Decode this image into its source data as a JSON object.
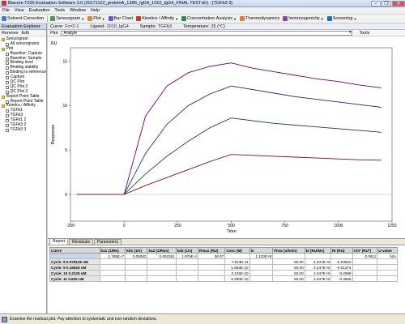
{
  "window": {
    "title": "Biacore T200 Evaluation Software 3.0 (20171122_proteinA_13A5_IgG4_1010_IgG4_FINAL TEST.blr) - [TGFb3 3]",
    "minimize": "–",
    "restore": "❐",
    "close": "✕"
  },
  "menu": [
    "File",
    "View",
    "Evaluation",
    "Tools",
    "Window",
    "Help"
  ],
  "toolbar": {
    "solvent": "Solvent Correction",
    "sensorgram": "Sensorgram",
    "plot": "Plot",
    "bar_chart": "Bar Chart",
    "kinetics": "Kinetics / Affinity",
    "concentration": "Concentration Analysis",
    "thermodynamics": "Thermodynamics",
    "immunogenicity": "Immunogenicity",
    "screening": "Screening"
  },
  "explorer": {
    "title": "Evaluation Explorer",
    "remove": "Remove",
    "edit": "Edit",
    "tree": [
      {
        "label": "Sensorgram",
        "level": 1,
        "folder": true
      },
      {
        "label": "All sensorgrams",
        "level": 2,
        "folder": false
      },
      {
        "label": "Plot",
        "level": 1,
        "folder": true
      },
      {
        "label": "Baseline: Capture",
        "level": 2,
        "folder": false
      },
      {
        "label": "Baseline: Sample",
        "level": 2,
        "folder": false
      },
      {
        "label": "Binding level",
        "level": 2,
        "folder": false
      },
      {
        "label": "Binding stability",
        "level": 2,
        "folder": false
      },
      {
        "label": "Binding to reference",
        "level": 2,
        "folder": false
      },
      {
        "label": "Capture",
        "level": 2,
        "folder": false
      },
      {
        "label": "QC Plot",
        "level": 2,
        "folder": false
      },
      {
        "label": "QC Plot 2",
        "level": 2,
        "folder": false
      },
      {
        "label": "QC Plot 3",
        "level": 2,
        "folder": false
      },
      {
        "label": "Report Point Table",
        "level": 1,
        "folder": true
      },
      {
        "label": "Report Point Table",
        "level": 2,
        "folder": false
      },
      {
        "label": "Kinetics / Affinity",
        "level": 1,
        "folder": true
      },
      {
        "label": "TGFb1",
        "level": 2,
        "folder": false
      },
      {
        "label": "TGFb3",
        "level": 2,
        "folder": false
      },
      {
        "label": "TGFb1 2",
        "level": 2,
        "folder": false
      },
      {
        "label": "TGFb3 2",
        "level": 2,
        "folder": false
      },
      {
        "label": "TGFb3 3",
        "level": 2,
        "folder": false
      }
    ]
  },
  "info": {
    "curve_label": "Curve:",
    "curve": "Fc=2-1",
    "ligand_label": "Ligand:",
    "ligand": "1010_IgG4",
    "sample_label": "Sample:",
    "sample": "TGFb3",
    "temp_label": "Temperature:",
    "temp": "25 (°C)"
  },
  "plotbar": {
    "label": "Plot",
    "combo": "Analyte",
    "tools": "Tools"
  },
  "chart_data": {
    "type": "line",
    "xlabel": "Time",
    "ylabel": "Response",
    "unit_label": "RU",
    "xlim": [
      -250,
      1250
    ],
    "ylim": [
      -3,
      16.5
    ],
    "xticks": [
      -250,
      0,
      250,
      500,
      750,
      1000,
      1250
    ],
    "yticks": [
      0,
      5,
      10,
      15
    ],
    "grid": false,
    "series": [
      {
        "color": "#b000b0",
        "fit_color": "#1a1a1a",
        "x": [
          0,
          100,
          200,
          300,
          400,
          500,
          600,
          700,
          800,
          900,
          1000,
          1100,
          1200
        ],
        "values": [
          0,
          8.8,
          12.2,
          13.7,
          14.4,
          14.8,
          14.2,
          13.8,
          13.4,
          13.0,
          12.7,
          12.3,
          12.0
        ]
      },
      {
        "color": "#2a3fd1",
        "fit_color": "#1a1a1a",
        "x": [
          0,
          100,
          200,
          300,
          400,
          500,
          600,
          700,
          800,
          900,
          1000,
          1100,
          1200
        ],
        "values": [
          0,
          4.6,
          7.9,
          10.0,
          11.3,
          12.2,
          11.8,
          11.4,
          11.0,
          10.7,
          10.4,
          10.1,
          9.8
        ]
      },
      {
        "color": "#1f7a1f",
        "fit_color": "#1a1a1a",
        "x": [
          0,
          100,
          200,
          300,
          400,
          500,
          600,
          700,
          800,
          900,
          1000,
          1100,
          1200
        ],
        "values": [
          0,
          2.3,
          4.3,
          6.0,
          7.5,
          8.6,
          8.3,
          8.0,
          7.8,
          7.6,
          7.4,
          7.2,
          7.0
        ]
      },
      {
        "color": "#c01818",
        "fit_color": "#1a1a1a",
        "x": [
          0,
          100,
          200,
          300,
          400,
          500,
          600,
          700,
          800,
          900,
          1000,
          1100,
          1200
        ],
        "values": [
          0,
          1.0,
          1.9,
          2.8,
          3.7,
          4.5,
          4.4,
          4.3,
          4.2,
          4.1,
          4.0,
          3.9,
          3.85
        ]
      }
    ]
  },
  "tabs": [
    "Report",
    "Residuals",
    "Parameters"
  ],
  "table": {
    "headers": [
      "Curve",
      "ka1 (1/Ms)",
      "kd1 (1/s)",
      "ka2 (1/RUs)",
      "kd2 (1/s)",
      "Rmax (RU)",
      "Conc (M)",
      "tc",
      "Flow (ul/min)",
      "kt (RU/Ms)",
      "RI (RU)",
      "Chi² (RU²)",
      "U-value"
    ],
    "rows": [
      [
        "",
        "1.785E+7",
        "0.05082",
        "0.002361",
        "1.975E-4",
        "36.57",
        "",
        "1.103E+8",
        "",
        "",
        "",
        "0.0911",
        "N/A"
      ],
      [
        "Cycle: 8 0.078125 nM",
        "",
        "",
        "",
        "",
        "",
        "7.813E-11",
        "",
        "50.00",
        "4.347E+8",
        "-0.04532",
        "",
        ""
      ],
      [
        "Cycle: 9 0.15625 nM",
        "",
        "",
        "",
        "",
        "",
        "1.563E-10",
        "",
        "50.00",
        "4.347E+8",
        "-0.01374",
        "",
        ""
      ],
      [
        "Cycle: 10 0.3125 nM",
        "",
        "",
        "",
        "",
        "",
        "3.125E-10",
        "",
        "50.00",
        "4.347E+8",
        "-0.2598",
        "",
        ""
      ],
      [
        "Cycle: 11 0.625 nM",
        "",
        "",
        "",
        "",
        "",
        "6.250E-10",
        "",
        "50.00",
        "4.347E+8",
        "-0.3656",
        "",
        ""
      ]
    ]
  },
  "status": {
    "message": "Examine the residual plot. Pay attention to systematic and non-random deviations."
  }
}
